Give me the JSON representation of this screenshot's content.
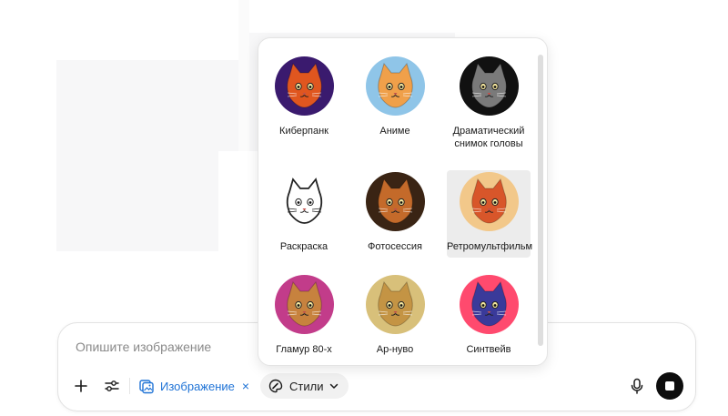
{
  "composer": {
    "placeholder": "Опишите изображение",
    "image_chip_label": "Изображение",
    "image_chip_close": "×",
    "styles_button_label": "Стили"
  },
  "styles": [
    {
      "id": "cyberpunk",
      "label": "Киберпанк",
      "icon": "cat-cyberpunk",
      "colors": [
        "#3a1a6e",
        "#e0561f"
      ]
    },
    {
      "id": "anime",
      "label": "Аниме",
      "icon": "cat-anime",
      "colors": [
        "#8fc5e8",
        "#f0a04a"
      ]
    },
    {
      "id": "dramatic-headshot",
      "label": "Драматический снимок головы",
      "icon": "cat-dramatic",
      "colors": [
        "#111111",
        "#7a7a7a"
      ]
    },
    {
      "id": "coloring",
      "label": "Раскраска",
      "icon": "cat-lineart",
      "colors": [
        "#ffffff",
        "#222222"
      ]
    },
    {
      "id": "photoshoot",
      "label": "Фотосессия",
      "icon": "cat-photo",
      "colors": [
        "#3a2414",
        "#c46a2a"
      ]
    },
    {
      "id": "retro-cartoon",
      "label": "Ретромультфильм",
      "icon": "cat-retro",
      "colors": [
        "#f2c88a",
        "#d8562a"
      ],
      "selected": true
    },
    {
      "id": "glamour-80s",
      "label": "Гламур 80-х",
      "icon": "cat-glamour",
      "colors": [
        "#c23c8a",
        "#c7823e"
      ]
    },
    {
      "id": "art-nouveau",
      "label": "Ар-нуво",
      "icon": "cat-artnouveau",
      "colors": [
        "#d8c07a",
        "#c49444"
      ]
    },
    {
      "id": "synthwave",
      "label": "Синтвейв",
      "icon": "cat-synthwave",
      "colors": [
        "#ff4a6e",
        "#3a3a9a"
      ]
    }
  ]
}
